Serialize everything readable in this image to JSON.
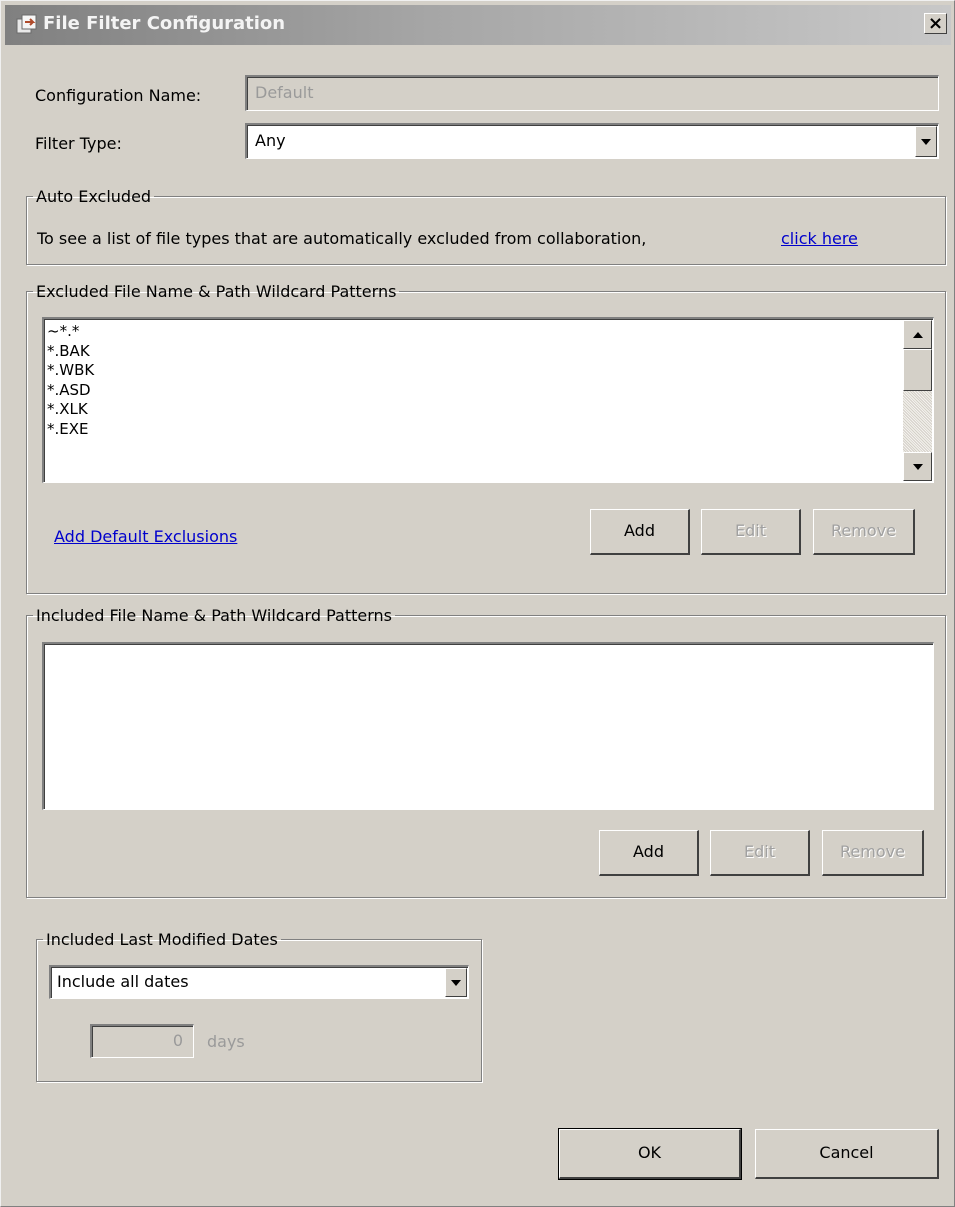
{
  "window": {
    "title": "File Filter Configuration",
    "close_label": "×"
  },
  "config_name": {
    "label": "Configuration Name:",
    "value": "Default"
  },
  "filter_type": {
    "label": "Filter Type:",
    "value": "Any"
  },
  "auto_excluded": {
    "legend": "Auto Excluded",
    "text": "To see a list of file types that are automatically excluded from collaboration,",
    "link": "click here"
  },
  "excluded_patterns": {
    "legend": "Excluded File Name & Path Wildcard Patterns",
    "items": [
      "~*.*",
      "*.BAK",
      "*.WBK",
      "*.ASD",
      "*.XLK",
      "*.EXE"
    ],
    "add_defaults_link": "Add Default Exclusions",
    "add_label": "Add",
    "edit_label": "Edit",
    "remove_label": "Remove"
  },
  "included_patterns": {
    "legend": "Included File Name & Path Wildcard Patterns",
    "items": [],
    "add_label": "Add",
    "edit_label": "Edit",
    "remove_label": "Remove"
  },
  "modified_dates": {
    "legend": "Included Last Modified Dates",
    "selected": "Include all dates",
    "days_value": "0",
    "days_label": "days"
  },
  "footer": {
    "ok_label": "OK",
    "cancel_label": "Cancel"
  },
  "colors": {
    "dialog_bg": "#d4d0c8",
    "link": "#0000cc",
    "disabled_text": "#a0a0a0"
  }
}
